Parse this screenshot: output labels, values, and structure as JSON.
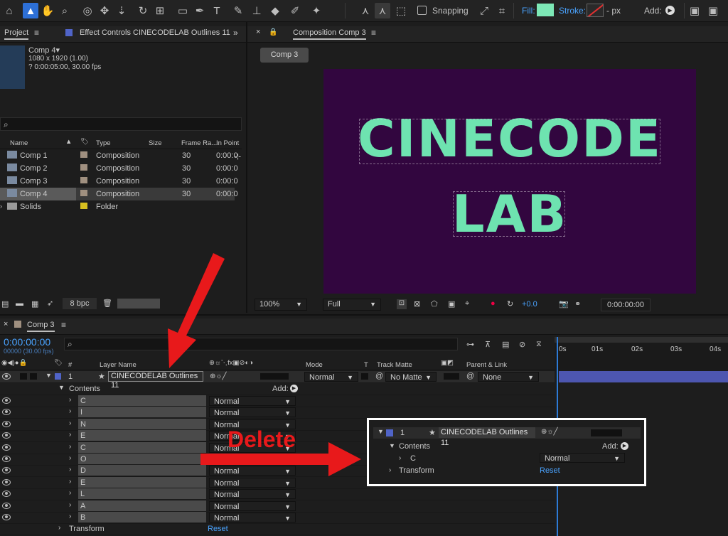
{
  "toolbar": {
    "snapping_label": "Snapping",
    "fill_label": "Fill:",
    "stroke_label": "Stroke:",
    "stroke_px": "- px",
    "add_label": "Add:",
    "fill_color": "#7de8b6"
  },
  "project_panel": {
    "tab_label": "Project",
    "effect_controls_label": "Effect Controls CINECODELAB Outlines 11",
    "preview_name": "Comp 4",
    "preview_size": "1080 x 1920 (1.00)",
    "preview_duration": "? 0:00:05:00, 30.00 fps",
    "columns": [
      "Name",
      "Type",
      "Size",
      "Frame Ra...",
      "In Point"
    ],
    "items": [
      {
        "name": "Comp 1",
        "type": "Composition",
        "fps": "30",
        "in": "0:00:0"
      },
      {
        "name": "Comp 2",
        "type": "Composition",
        "fps": "30",
        "in": "0:00:0"
      },
      {
        "name": "Comp 3",
        "type": "Composition",
        "fps": "30",
        "in": "0:00:0"
      },
      {
        "name": "Comp 4",
        "type": "Composition",
        "fps": "30",
        "in": "0:00:0"
      },
      {
        "name": "Solids",
        "type": "Folder",
        "fps": "",
        "in": ""
      }
    ],
    "bpc_label": "8 bpc"
  },
  "comp_panel": {
    "tab_label": "Composition Comp 3",
    "comp_button": "Comp 3",
    "canvas_line1": "CINECODE",
    "canvas_line2": "LAB",
    "canvas_bg": "#32063f",
    "text_color": "#6ee3b0",
    "zoom": "100%",
    "resolution": "Full",
    "exposure": "+0.0",
    "timecode": "0:00:00:00"
  },
  "timeline": {
    "tab_label": "Comp 3",
    "timecode": "0:00:00:00",
    "frames": "00000 (30.00 fps)",
    "columns": {
      "layer_name": "Layer Name",
      "mode": "Mode",
      "t": "T",
      "track_matte": "Track Matte",
      "parent": "Parent & Link"
    },
    "layer": {
      "index": "1",
      "name": "CINECODELAB Outlines 11",
      "mode": "Normal",
      "matte": "No Matte",
      "parent": "None"
    },
    "contents_label": "Contents",
    "add_label": "Add:",
    "groups": [
      {
        "name": "C",
        "mode": "Normal"
      },
      {
        "name": "I",
        "mode": "Normal"
      },
      {
        "name": "N",
        "mode": "Normal"
      },
      {
        "name": "E",
        "mode": "Normal"
      },
      {
        "name": "C",
        "mode": "Normal"
      },
      {
        "name": "O",
        "mode": ""
      },
      {
        "name": "D",
        "mode": "Normal"
      },
      {
        "name": "E",
        "mode": "Normal"
      },
      {
        "name": "L",
        "mode": "Normal"
      },
      {
        "name": "A",
        "mode": "Normal"
      },
      {
        "name": "B",
        "mode": "Normal"
      }
    ],
    "transform_label": "Transform",
    "reset_label": "Reset",
    "ruler": [
      "0s",
      "01s",
      "02s",
      "03s",
      "04s"
    ]
  },
  "annotation": {
    "delete_label": "Delete",
    "inset": {
      "index": "1",
      "layer_name": "CINECODELAB Outlines 11",
      "contents": "Contents",
      "add": "Add:",
      "group": "C",
      "mode": "Normal",
      "transform": "Transform",
      "reset": "Reset"
    },
    "arrow_color": "#e8191b"
  }
}
